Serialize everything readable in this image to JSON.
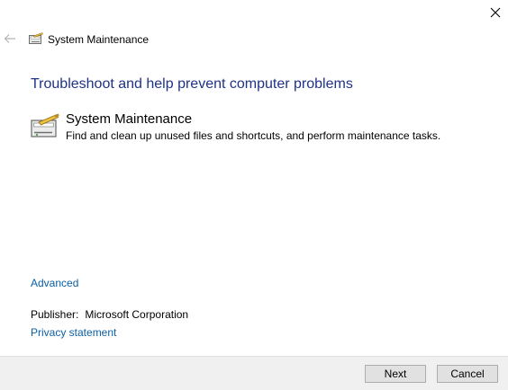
{
  "window": {
    "title": "System Maintenance",
    "close_glyph": "✕",
    "back_glyph": "←"
  },
  "main": {
    "heading": "Troubleshoot and help prevent computer problems",
    "task": {
      "title": "System Maintenance",
      "description": "Find and clean up unused files and shortcuts, and perform maintenance tasks.",
      "icon": "system-maintenance-icon"
    },
    "advanced_link": "Advanced",
    "publisher_label": "Publisher:",
    "publisher_value": "Microsoft Corporation",
    "privacy_link": "Privacy statement"
  },
  "footer": {
    "next_label": "Next",
    "cancel_label": "Cancel"
  },
  "colors": {
    "heading": "#1e3287",
    "link": "#0b5fa5",
    "footer_bg": "#f0f0f0",
    "button_bg": "#e1e1e1"
  }
}
